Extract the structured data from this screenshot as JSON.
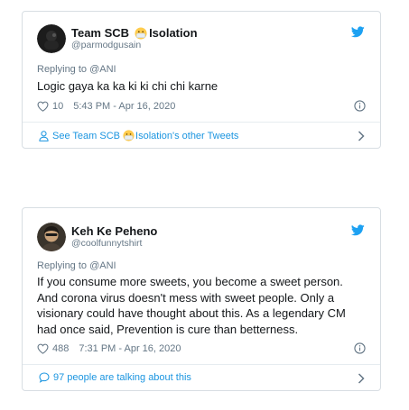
{
  "tweets": [
    {
      "display_name": "Team SCB",
      "display_name_suffix": "Isolation",
      "handle": "@parmodgusain",
      "reply_to": "Replying to @ANI",
      "text": "Logic gaya ka ka ki ki chi chi karne",
      "likes": "10",
      "timestamp": "5:43 PM - Apr 16, 2020",
      "footer_prefix": "See Team SCB",
      "footer_suffix": "Isolation's other Tweets"
    },
    {
      "display_name": "Keh Ke Peheno",
      "handle": "@coolfunnytshirt",
      "reply_to": "Replying to @ANI",
      "text": "If you consume more sweets, you become a sweet person. And corona virus doesn't mess with sweet people. Only a visionary could have thought about this. As a legendary CM had once said, Prevention is cure than betterness.",
      "likes": "488",
      "timestamp": "7:31 PM - Apr 16, 2020",
      "footer": "97 people are talking about this"
    }
  ],
  "colors": {
    "link": "#1b95e0",
    "muted": "#657786",
    "text": "#14171a",
    "twitter_blue": "#1da1f2"
  },
  "icons": [
    "twitter-bird-icon",
    "heart-icon",
    "info-icon",
    "person-icon",
    "comment-icon",
    "chevron-right-icon",
    "mask-emoji-icon"
  ]
}
